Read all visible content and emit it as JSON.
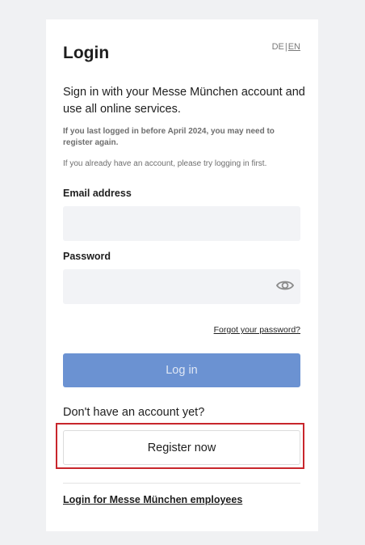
{
  "language": {
    "de": "DE",
    "separator": "|",
    "en": "EN"
  },
  "title": "Login",
  "intro": "Sign in with your Messe München account and use all online services.",
  "notice_bold": "If you last logged in before April 2024, you may need to register again.",
  "notice": "If you already have an account, please try logging in first.",
  "email": {
    "label": "Email address",
    "value": "",
    "placeholder": ""
  },
  "password": {
    "label": "Password",
    "value": "",
    "placeholder": ""
  },
  "icons": {
    "password_toggle": "eye-icon"
  },
  "forgot_password": "Forgot your password?",
  "login_button": "Log in",
  "no_account": "Don't have an account yet?",
  "register_button": "Register now",
  "employee_login": "Login for Messe München employees",
  "colors": {
    "login_button_bg": "#6b92d2",
    "highlight_border": "#c8262c",
    "page_bg": "#f0f1f3",
    "input_bg": "#f2f3f6"
  }
}
